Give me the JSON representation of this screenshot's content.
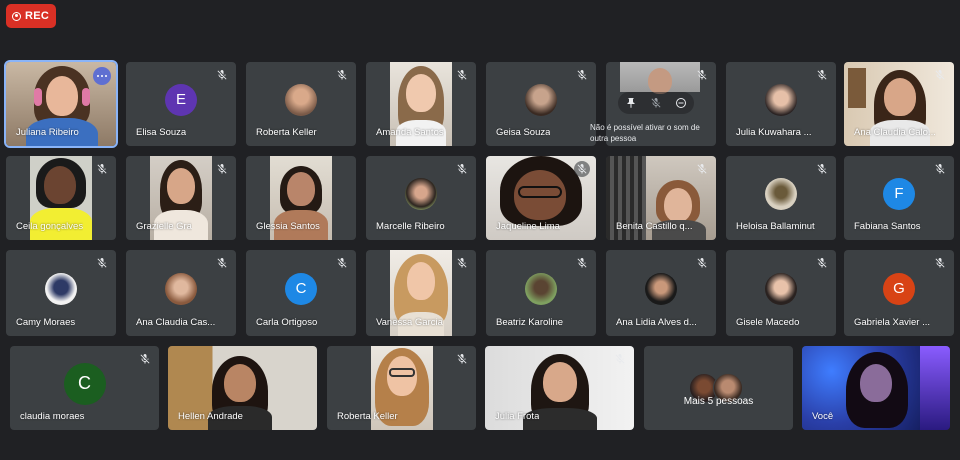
{
  "rec_badge": {
    "label": "REC"
  },
  "colors": {
    "accent_blue": "#8ab4f8",
    "rec_red": "#d93025",
    "tile_bg": "#3c4043",
    "page_bg": "#202124"
  },
  "participants": [
    {
      "name": "Juliana Ribeiro"
    },
    {
      "name": "Elisa Souza",
      "initial": "E"
    },
    {
      "name": "Roberta Keller"
    },
    {
      "name": "Amanda Santos"
    },
    {
      "name": "Geisa Souza"
    },
    {
      "name": ""
    },
    {
      "name": "Julia Kuwahara ..."
    },
    {
      "name": "Ana Claudia Calo..."
    },
    {
      "name": "Ceila gonçalves"
    },
    {
      "name": "Grazielle Gra"
    },
    {
      "name": "Glessia Santos"
    },
    {
      "name": "Marcelle Ribeiro"
    },
    {
      "name": "Jaqueline Lima"
    },
    {
      "name": "Benita Castillo q..."
    },
    {
      "name": "Heloisa Ballaminut"
    },
    {
      "name": "Fabiana Santos",
      "initial": "F"
    },
    {
      "name": "Camy Moraes"
    },
    {
      "name": "Ana Claudia Cas..."
    },
    {
      "name": "Carla Ortigoso",
      "initial": "C"
    },
    {
      "name": "Vanessa Garcia"
    },
    {
      "name": "Beatriz Karoline"
    },
    {
      "name": "Ana Lidia Alves d..."
    },
    {
      "name": "Gisele Macedo"
    },
    {
      "name": "Gabriela Xavier ...",
      "initial": "G"
    },
    {
      "name": "claudia moraes",
      "initial": "C"
    },
    {
      "name": "Hellen Andrade"
    },
    {
      "name": "Roberta Keller"
    },
    {
      "name": "Julia Frota"
    },
    {
      "name": "Você"
    }
  ],
  "more_people": {
    "label": "Mais 5 pessoas"
  },
  "tooltip": {
    "text": "Não é possível ativar o som de outra pessoa"
  }
}
